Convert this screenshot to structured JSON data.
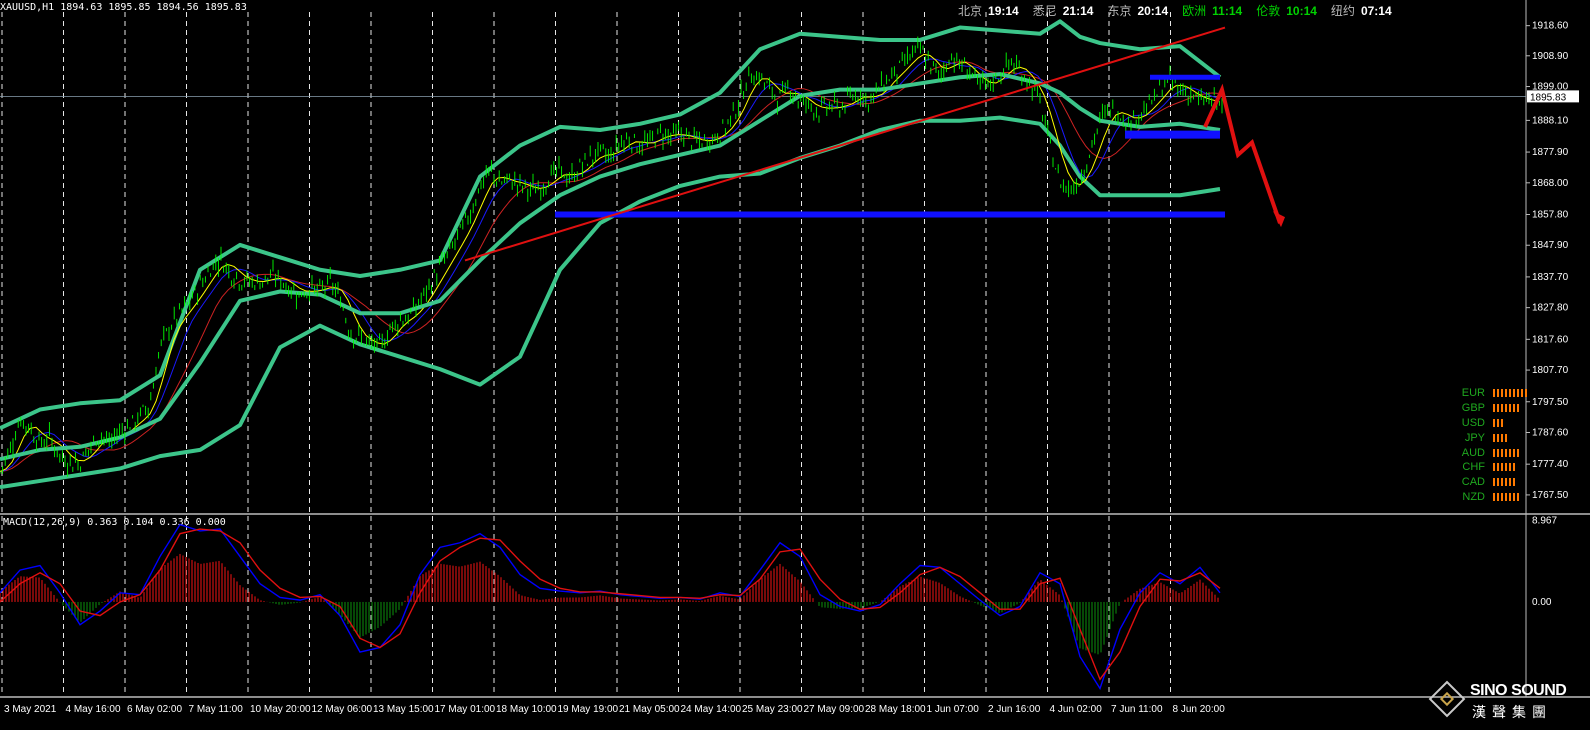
{
  "header": {
    "symbol_info": "XAUUSD,H1  1894.63 1895.85 1894.56 1895.83",
    "clocks": [
      {
        "city": "北京",
        "time": "19:14",
        "green": false
      },
      {
        "city": "悉尼",
        "time": "21:14",
        "green": false
      },
      {
        "city": "东京",
        "time": "20:14",
        "green": false
      },
      {
        "city": "欧洲",
        "time": "11:14",
        "green": true
      },
      {
        "city": "伦敦",
        "time": "10:14",
        "green": true
      },
      {
        "city": "纽约",
        "time": "07:14",
        "green": false
      }
    ]
  },
  "chart_data": [
    {
      "type": "candlestick",
      "symbol": "XAUUSD",
      "timeframe": "H1",
      "ohlc_last": {
        "open": 1894.63,
        "high": 1895.85,
        "low": 1894.56,
        "close": 1895.83
      },
      "current_price_label": "1895.83",
      "ylim": [
        1762.0,
        1923.0
      ],
      "y_ticks": [
        "1918.60",
        "1908.90",
        "1899.00",
        "1888.10",
        "1877.90",
        "1868.00",
        "1857.80",
        "1847.90",
        "1837.70",
        "1827.80",
        "1817.60",
        "1807.70",
        "1797.50",
        "1787.60",
        "1777.40",
        "1767.50"
      ],
      "x_ticks": [
        "3 May 2021",
        "4 May 16:00",
        "6 May 02:00",
        "7 May 11:00",
        "10 May 20:00",
        "12 May 06:00",
        "13 May 15:00",
        "17 May 01:00",
        "18 May 10:00",
        "19 May 19:00",
        "21 May 05:00",
        "24 May 14:00",
        "25 May 23:00",
        "27 May 09:00",
        "28 May 18:00",
        "1 Jun 07:00",
        "2 Jun 16:00",
        "4 Jun 02:00",
        "7 Jun 11:00",
        "8 Jun 20:00"
      ],
      "price_path_x": [
        0,
        10,
        20,
        30,
        40,
        50,
        60,
        70,
        80,
        90,
        100,
        110,
        120,
        130,
        140,
        150,
        160,
        170,
        180,
        190,
        200,
        210,
        220,
        230,
        240,
        250,
        260,
        270,
        280,
        290,
        300,
        310,
        320,
        330,
        340,
        350,
        360,
        370,
        380,
        390,
        400,
        410,
        420,
        430,
        440,
        450,
        460,
        470,
        480,
        490,
        500,
        510,
        520,
        530,
        540,
        550,
        560,
        570,
        580,
        590,
        600,
        610,
        620,
        630,
        640,
        650,
        660,
        670,
        680,
        690,
        700,
        710,
        720,
        730,
        740,
        750,
        760,
        770,
        780,
        790,
        800,
        810,
        820,
        830,
        840,
        850,
        860,
        870,
        880,
        890,
        900,
        910,
        920,
        930,
        940,
        950,
        960,
        970,
        980,
        990,
        1000,
        1010,
        1020,
        1030,
        1040,
        1050,
        1060,
        1070,
        1080,
        1090,
        1100,
        1110,
        1120,
        1130,
        1140,
        1150,
        1160,
        1170,
        1180,
        1190,
        1200,
        1210,
        1220,
        1230
      ],
      "price_path_y": [
        1775,
        1782,
        1792,
        1789,
        1784,
        1786,
        1780,
        1778,
        1778,
        1783,
        1787,
        1784,
        1788,
        1790,
        1793,
        1797,
        1815,
        1822,
        1826,
        1830,
        1835,
        1840,
        1844,
        1839,
        1837,
        1836,
        1836,
        1838,
        1837,
        1834,
        1832,
        1834,
        1833,
        1836,
        1831,
        1820,
        1818,
        1816,
        1815,
        1821,
        1824,
        1825,
        1830,
        1835,
        1841,
        1846,
        1852,
        1858,
        1867,
        1872,
        1868,
        1869,
        1867,
        1866,
        1866,
        1870,
        1872,
        1869,
        1873,
        1876,
        1878,
        1876,
        1881,
        1882,
        1880,
        1881,
        1884,
        1883,
        1884,
        1882,
        1881,
        1882,
        1884,
        1888,
        1895,
        1903,
        1902,
        1898,
        1895,
        1899,
        1894,
        1893,
        1891,
        1893,
        1892,
        1895,
        1897,
        1894,
        1899,
        1902,
        1905,
        1909,
        1911,
        1906,
        1902,
        1909,
        1906,
        1904,
        1899,
        1900,
        1903,
        1907,
        1904,
        1900,
        1894,
        1880,
        1868,
        1866,
        1869,
        1878,
        1888,
        1892,
        1890,
        1887,
        1891,
        1893,
        1898,
        1901,
        1898,
        1897,
        1894,
        1895,
        1893,
        1896
      ],
      "bollinger_upper": {
        "x": [
          0,
          40,
          80,
          120,
          160,
          200,
          240,
          280,
          320,
          360,
          400,
          440,
          480,
          520,
          560,
          600,
          640,
          680,
          720,
          760,
          800,
          840,
          880,
          920,
          960,
          1000,
          1040,
          1060,
          1080,
          1100,
          1140,
          1180,
          1220
        ],
        "y": [
          1789,
          1795,
          1797,
          1798,
          1806,
          1840,
          1848,
          1844,
          1840,
          1838,
          1840,
          1843,
          1870,
          1880,
          1886,
          1885,
          1887,
          1890,
          1897,
          1911,
          1916,
          1915,
          1914,
          1914,
          1918,
          1917,
          1916,
          1920,
          1915,
          1913,
          1911,
          1912,
          1902
        ]
      },
      "bollinger_mid": {
        "x": [
          0,
          40,
          80,
          120,
          160,
          200,
          240,
          280,
          320,
          360,
          400,
          440,
          480,
          520,
          560,
          600,
          640,
          680,
          720,
          760,
          800,
          840,
          880,
          920,
          960,
          1000,
          1040,
          1060,
          1080,
          1100,
          1140,
          1180,
          1220
        ],
        "y": [
          1779,
          1782,
          1783,
          1786,
          1792,
          1810,
          1830,
          1833,
          1832,
          1826,
          1826,
          1830,
          1843,
          1855,
          1864,
          1870,
          1874,
          1877,
          1880,
          1888,
          1896,
          1898,
          1898,
          1900,
          1902,
          1903,
          1900,
          1897,
          1892,
          1888,
          1886,
          1887,
          1885
        ]
      },
      "bollinger_lower": {
        "x": [
          0,
          40,
          80,
          120,
          160,
          200,
          240,
          280,
          320,
          360,
          400,
          440,
          480,
          520,
          560,
          600,
          640,
          680,
          720,
          760,
          800,
          840,
          880,
          920,
          960,
          1000,
          1040,
          1060,
          1080,
          1100,
          1140,
          1180,
          1220
        ],
        "y": [
          1770,
          1772,
          1774,
          1776,
          1780,
          1782,
          1790,
          1815,
          1822,
          1816,
          1812,
          1808,
          1803,
          1812,
          1840,
          1855,
          1862,
          1867,
          1870,
          1871,
          1876,
          1880,
          1885,
          1888,
          1888,
          1889,
          1887,
          1880,
          1870,
          1864,
          1864,
          1864,
          1866
        ]
      },
      "annotations": {
        "support_line": {
          "x": [
            555,
            1225
          ],
          "y": 1857.8
        },
        "range_top": {
          "x": [
            1150,
            1220
          ],
          "y": 1902.0
        },
        "range_bottom": {
          "x": [
            1125,
            1220
          ],
          "y": 1883.5
        },
        "trendline": {
          "x": [
            465,
            1225
          ],
          "y": [
            1843,
            1918
          ]
        },
        "forecast_arrow": {
          "x": [
            1205,
            1222,
            1238,
            1252,
            1280
          ],
          "y": [
            1886,
            1898,
            1877,
            1881,
            1855
          ]
        }
      }
    },
    {
      "type": "macd",
      "label": "MACD(12,26,9) 0.363 0.104 0.336 0.000",
      "params": [
        12,
        26,
        9
      ],
      "values": [
        0.363,
        0.104,
        0.336,
        0.0
      ],
      "ylim": [
        -10.0,
        9.0
      ],
      "y_ticks": [
        "8.967",
        "0.00"
      ],
      "macd_x": [
        0,
        20,
        40,
        60,
        80,
        100,
        120,
        140,
        160,
        180,
        200,
        220,
        240,
        260,
        280,
        300,
        320,
        340,
        360,
        380,
        400,
        420,
        440,
        460,
        480,
        500,
        520,
        540,
        560,
        580,
        600,
        620,
        640,
        660,
        680,
        700,
        720,
        740,
        760,
        780,
        800,
        820,
        840,
        860,
        880,
        900,
        920,
        940,
        960,
        980,
        1000,
        1020,
        1040,
        1060,
        1080,
        1100,
        1120,
        1140,
        1160,
        1180,
        1200,
        1220
      ],
      "macd_y": [
        1.0,
        3.5,
        4.0,
        1.0,
        -2.5,
        -1.0,
        1.0,
        0.8,
        5.0,
        8.5,
        7.8,
        8.0,
        5.0,
        2.0,
        0.5,
        0.2,
        0.8,
        -1.5,
        -5.5,
        -5.0,
        -2.5,
        3.0,
        6.0,
        6.5,
        7.5,
        6.0,
        3.0,
        1.5,
        1.2,
        1.0,
        1.2,
        0.8,
        0.6,
        0.4,
        0.5,
        0.3,
        1.0,
        0.6,
        3.5,
        6.5,
        5.0,
        0.8,
        -0.5,
        -1.0,
        -0.3,
        2.0,
        4.0,
        3.8,
        2.0,
        0.2,
        -1.5,
        -0.5,
        3.2,
        2.0,
        -6.0,
        -9.5,
        -3.0,
        1.0,
        3.2,
        2.0,
        3.8,
        1.0
      ],
      "signal_y": [
        0.0,
        2.0,
        3.2,
        2.0,
        -1.0,
        -1.5,
        0.0,
        0.8,
        3.5,
        7.5,
        8.0,
        7.8,
        6.5,
        3.5,
        1.5,
        0.5,
        0.6,
        -0.5,
        -4.0,
        -5.0,
        -3.5,
        1.0,
        4.5,
        6.0,
        7.0,
        6.8,
        4.5,
        2.5,
        1.5,
        1.1,
        1.1,
        0.9,
        0.7,
        0.5,
        0.5,
        0.4,
        0.8,
        0.7,
        2.5,
        5.5,
        5.8,
        2.5,
        0.3,
        -0.8,
        -0.6,
        1.0,
        3.0,
        3.8,
        2.8,
        1.0,
        -0.8,
        -0.8,
        2.0,
        2.6,
        -3.0,
        -8.5,
        -5.5,
        -0.5,
        2.5,
        2.3,
        3.2,
        1.5
      ]
    }
  ],
  "currency_strength": [
    {
      "name": "EUR",
      "strength": 9
    },
    {
      "name": "GBP",
      "strength": 7
    },
    {
      "name": "USD",
      "strength": 3
    },
    {
      "name": "JPY",
      "strength": 4
    },
    {
      "name": "AUD",
      "strength": 7
    },
    {
      "name": "CHF",
      "strength": 6
    },
    {
      "name": "CAD",
      "strength": 6
    },
    {
      "name": "NZD",
      "strength": 7
    }
  ],
  "logo": {
    "brand": "SINO SOUND",
    "chinese": "漢聲集團"
  },
  "colors": {
    "background": "#000000",
    "candle": "#00ff00",
    "bollinger": "#3cc58a",
    "ma_fast": "#ffff00",
    "ma_mid": "#1a1aff",
    "ma_slow": "#cc2222",
    "support": "#1010ff",
    "trendline": "#e01010",
    "macd_line": "#0000ff",
    "signal_line": "#e01010",
    "hist_pos": "#cc1010",
    "hist_neg": "#0a7a0a"
  }
}
